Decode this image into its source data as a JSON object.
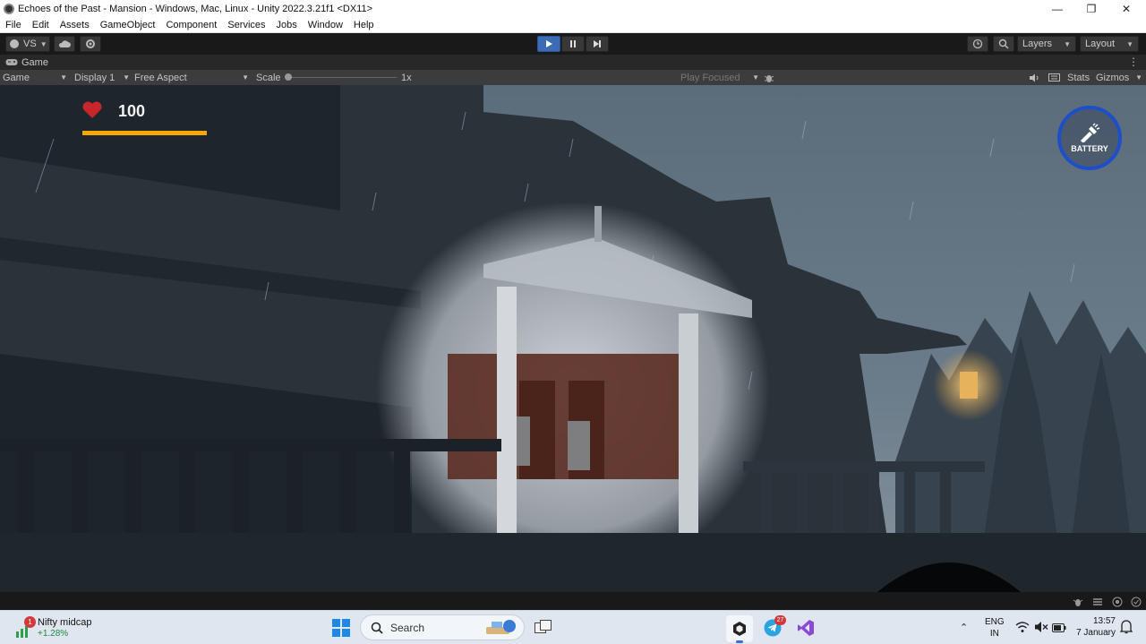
{
  "window": {
    "title": "Echoes of the Past - Mansion - Windows, Mac, Linux - Unity 2022.3.21f1 <DX11>"
  },
  "menu": [
    "File",
    "Edit",
    "Assets",
    "GameObject",
    "Component",
    "Services",
    "Jobs",
    "Window",
    "Help"
  ],
  "toolbar": {
    "account_label": "VS",
    "layers_label": "Layers",
    "layout_label": "Layout"
  },
  "tab": {
    "label": "Game"
  },
  "gamebar": {
    "view_select": "Game",
    "display_select": "Display 1",
    "aspect_select": "Free Aspect",
    "scale_label": "Scale",
    "scale_value": "1x",
    "play_focused": "Play Focused",
    "stats_label": "Stats",
    "gizmos_label": "Gizmos"
  },
  "hud": {
    "health_value": "100",
    "health_fraction": 1.0,
    "battery_label": "BATTERY"
  },
  "taskbar": {
    "widget_badge": "1",
    "widget_title": "Nifty midcap",
    "widget_change": "+1.28%",
    "search_placeholder": "Search",
    "telegram_badge": "27",
    "lang_line1": "ENG",
    "lang_line2": "IN",
    "time": "13:57",
    "date": "7 January"
  },
  "colors": {
    "health_bar": "#f5a800",
    "battery_ring": "#1e4fc9",
    "play_active": "#3b6cb5"
  }
}
